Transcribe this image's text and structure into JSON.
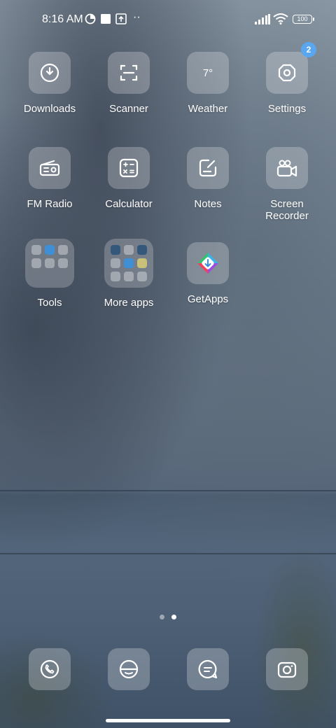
{
  "status_bar": {
    "time": "8:16 AM",
    "battery": "100",
    "more": "··"
  },
  "apps": [
    {
      "label": "Downloads",
      "icon": "download-icon"
    },
    {
      "label": "Scanner",
      "icon": "scan-icon"
    },
    {
      "label": "Weather",
      "icon": "weather-icon",
      "temp": "7°"
    },
    {
      "label": "Settings",
      "icon": "gear-icon",
      "badge": "2"
    },
    {
      "label": "FM Radio",
      "icon": "radio-icon"
    },
    {
      "label": "Calculator",
      "icon": "calculator-icon"
    },
    {
      "label": "Notes",
      "icon": "notes-icon"
    },
    {
      "label": "Screen\nRecorder",
      "icon": "video-camera-icon"
    },
    {
      "label": "Tools",
      "icon": "folder-icon"
    },
    {
      "label": "More apps",
      "icon": "folder-icon"
    },
    {
      "label": "GetApps",
      "icon": "getapps-icon"
    }
  ],
  "pages": {
    "count": 2,
    "current": 2
  },
  "dock": [
    {
      "icon": "phone-icon"
    },
    {
      "icon": "browser-icon"
    },
    {
      "icon": "messages-icon"
    },
    {
      "icon": "camera-icon"
    }
  ],
  "colors": {
    "badge": "#5aa7ef",
    "tile": "rgba(255,255,255,0.24)"
  }
}
